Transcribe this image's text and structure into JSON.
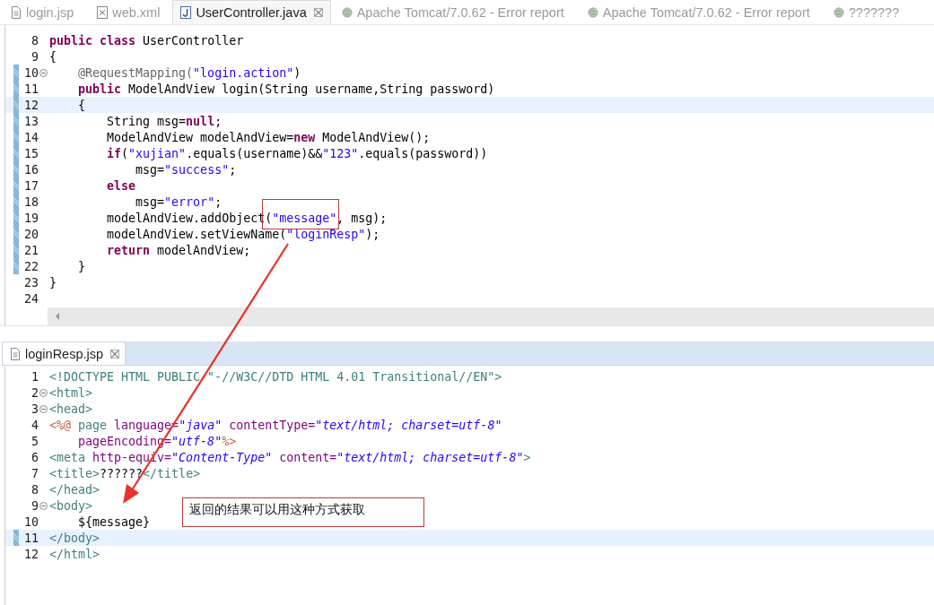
{
  "editor_tabs": [
    {
      "label": "login.jsp",
      "kind": "jsp",
      "selected": false,
      "closable": false
    },
    {
      "label": "web.xml",
      "kind": "xml",
      "selected": false,
      "closable": false
    },
    {
      "label": "UserController.java",
      "kind": "java",
      "selected": true,
      "closable": true
    },
    {
      "label": "Apache Tomcat/7.0.62 - Error report",
      "kind": "web",
      "selected": false,
      "closable": false
    },
    {
      "label": "Apache Tomcat/7.0.62 - Error report",
      "kind": "web",
      "selected": false,
      "closable": false
    },
    {
      "label": "???????",
      "kind": "web",
      "selected": false,
      "closable": false
    }
  ],
  "java_editor": {
    "lines": [
      {
        "number": "8",
        "changed": false,
        "current": false,
        "foldable": false,
        "tokens": [
          {
            "kind": "kw",
            "text": "public class"
          },
          {
            "kind": "plain",
            "text": " UserController"
          }
        ]
      },
      {
        "number": "9",
        "changed": false,
        "current": false,
        "foldable": false,
        "tokens": [
          {
            "kind": "plain",
            "text": "{"
          }
        ]
      },
      {
        "number": "10",
        "changed": true,
        "current": false,
        "foldable": true,
        "tokens": [
          {
            "kind": "ann",
            "text": "    @RequestMapping("
          },
          {
            "kind": "str",
            "text": "\"login.action\""
          },
          {
            "kind": "plain",
            "text": ")"
          }
        ]
      },
      {
        "number": "11",
        "changed": true,
        "current": false,
        "foldable": false,
        "tokens": [
          {
            "kind": "kw",
            "text": "    public"
          },
          {
            "kind": "plain",
            "text": " ModelAndView login(String username,String password)"
          }
        ]
      },
      {
        "number": "12",
        "changed": true,
        "current": true,
        "foldable": false,
        "tokens": [
          {
            "kind": "plain",
            "text": "    {"
          }
        ]
      },
      {
        "number": "13",
        "changed": true,
        "current": false,
        "foldable": false,
        "tokens": [
          {
            "kind": "plain",
            "text": "        String msg="
          },
          {
            "kind": "kw",
            "text": "null"
          },
          {
            "kind": "plain",
            "text": ";"
          }
        ]
      },
      {
        "number": "14",
        "changed": true,
        "current": false,
        "foldable": false,
        "tokens": [
          {
            "kind": "plain",
            "text": "        ModelAndView modelAndView="
          },
          {
            "kind": "kw",
            "text": "new"
          },
          {
            "kind": "plain",
            "text": " ModelAndView();"
          }
        ]
      },
      {
        "number": "15",
        "changed": true,
        "current": false,
        "foldable": false,
        "tokens": [
          {
            "kind": "kw",
            "text": "        if"
          },
          {
            "kind": "plain",
            "text": "("
          },
          {
            "kind": "str",
            "text": "\"xujian\""
          },
          {
            "kind": "plain",
            "text": ".equals(username)&&"
          },
          {
            "kind": "str",
            "text": "\"123\""
          },
          {
            "kind": "plain",
            "text": ".equals(password))"
          }
        ]
      },
      {
        "number": "16",
        "changed": true,
        "current": false,
        "foldable": false,
        "tokens": [
          {
            "kind": "plain",
            "text": "            msg="
          },
          {
            "kind": "str",
            "text": "\"success\""
          },
          {
            "kind": "plain",
            "text": ";"
          }
        ]
      },
      {
        "number": "17",
        "changed": true,
        "current": false,
        "foldable": false,
        "tokens": [
          {
            "kind": "kw",
            "text": "        else"
          }
        ]
      },
      {
        "number": "18",
        "changed": true,
        "current": false,
        "foldable": false,
        "tokens": [
          {
            "kind": "plain",
            "text": "            msg="
          },
          {
            "kind": "str",
            "text": "\"error\""
          },
          {
            "kind": "plain",
            "text": ";"
          }
        ]
      },
      {
        "number": "19",
        "changed": true,
        "current": false,
        "foldable": false,
        "tokens": [
          {
            "kind": "plain",
            "text": "        modelAndView.addObject("
          },
          {
            "kind": "str",
            "text": "\"message\""
          },
          {
            "kind": "plain",
            "text": ", msg);"
          }
        ]
      },
      {
        "number": "20",
        "changed": true,
        "current": false,
        "foldable": false,
        "tokens": [
          {
            "kind": "plain",
            "text": "        modelAndView.setViewName("
          },
          {
            "kind": "str",
            "text": "\"loginResp\""
          },
          {
            "kind": "plain",
            "text": ");"
          }
        ]
      },
      {
        "number": "21",
        "changed": true,
        "current": false,
        "foldable": false,
        "tokens": [
          {
            "kind": "kw",
            "text": "        return"
          },
          {
            "kind": "plain",
            "text": " modelAndView;"
          }
        ]
      },
      {
        "number": "22",
        "changed": true,
        "current": false,
        "foldable": false,
        "tokens": [
          {
            "kind": "plain",
            "text": "    }"
          }
        ]
      },
      {
        "number": "23",
        "changed": false,
        "current": false,
        "foldable": false,
        "tokens": [
          {
            "kind": "plain",
            "text": "}"
          }
        ]
      },
      {
        "number": "24",
        "changed": false,
        "current": false,
        "foldable": false
      }
    ]
  },
  "jsp_tab": {
    "label": "loginResp.jsp",
    "kind": "jsp",
    "selected": true,
    "closable": true
  },
  "jsp_editor": {
    "lines": [
      {
        "number": "1",
        "changed": false,
        "current": false,
        "foldable": false,
        "tokens": [
          {
            "kind": "tag",
            "text": "<!DOCTYPE HTML PUBLIC \"-//W3C//DTD HTML 4.01 Transitional//EN\">"
          }
        ]
      },
      {
        "number": "2",
        "changed": false,
        "current": false,
        "foldable": true,
        "tokens": [
          {
            "kind": "tag",
            "text": "<html>"
          }
        ]
      },
      {
        "number": "3",
        "changed": false,
        "current": false,
        "foldable": true,
        "tokens": [
          {
            "kind": "tag",
            "text": "<head>"
          }
        ]
      },
      {
        "number": "4",
        "changed": false,
        "current": false,
        "foldable": false,
        "tokens": [
          {
            "kind": "jsp",
            "text": "<%@"
          },
          {
            "kind": "tag",
            "text": " page"
          },
          {
            "kind": "attr",
            "text": " language="
          },
          {
            "kind": "aval",
            "text": "\"java\""
          },
          {
            "kind": "attr",
            "text": " contentType="
          },
          {
            "kind": "aval",
            "text": "\"text/html; charset=utf-8\""
          }
        ]
      },
      {
        "number": "5",
        "changed": false,
        "current": false,
        "foldable": false,
        "tokens": [
          {
            "kind": "attr",
            "text": "    pageEncoding="
          },
          {
            "kind": "aval",
            "text": "\"utf-8\""
          },
          {
            "kind": "jsp",
            "text": "%>"
          }
        ]
      },
      {
        "number": "6",
        "changed": false,
        "current": false,
        "foldable": false,
        "tokens": [
          {
            "kind": "tag",
            "text": "<meta"
          },
          {
            "kind": "attr",
            "text": " http-equiv="
          },
          {
            "kind": "aval",
            "text": "\"Content-Type\""
          },
          {
            "kind": "attr",
            "text": " content="
          },
          {
            "kind": "aval",
            "text": "\"text/html; charset=utf-8\""
          },
          {
            "kind": "tag",
            "text": ">"
          }
        ]
      },
      {
        "number": "7",
        "changed": false,
        "current": false,
        "foldable": false,
        "tokens": [
          {
            "kind": "tag",
            "text": "<title>"
          },
          {
            "kind": "plain",
            "text": "??????"
          },
          {
            "kind": "tag",
            "text": "</title>"
          }
        ]
      },
      {
        "number": "8",
        "changed": false,
        "current": false,
        "foldable": false,
        "tokens": [
          {
            "kind": "tag",
            "text": "</head>"
          }
        ]
      },
      {
        "number": "9",
        "changed": false,
        "current": false,
        "foldable": true,
        "tokens": [
          {
            "kind": "tag",
            "text": "<body>"
          }
        ]
      },
      {
        "number": "10",
        "changed": false,
        "current": false,
        "foldable": false,
        "tokens": [
          {
            "kind": "plain",
            "text": "    ${message}"
          }
        ]
      },
      {
        "number": "11",
        "changed": true,
        "current": true,
        "foldable": false,
        "tokens": [
          {
            "kind": "tag",
            "text": "</body>"
          }
        ]
      },
      {
        "number": "12",
        "changed": false,
        "current": false,
        "foldable": false,
        "tokens": [
          {
            "kind": "tag",
            "text": "</html>"
          }
        ]
      }
    ]
  },
  "callout": {
    "text": "返回的结果可以用这种方式获取"
  }
}
